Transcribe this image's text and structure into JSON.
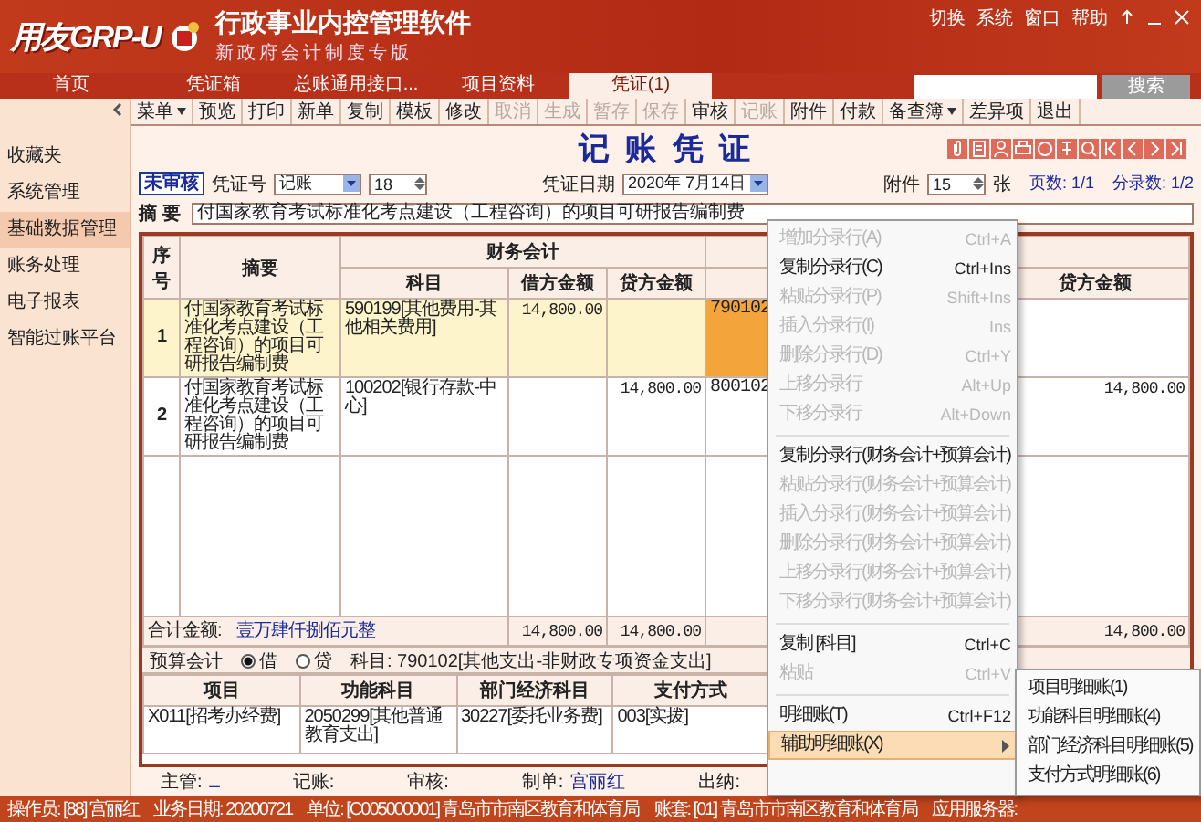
{
  "app": {
    "logo": "用友GRP-U",
    "title": "行政事业内控管理软件",
    "subtitle": "新政府会计制度专版",
    "top_menu": [
      "切换",
      "系统",
      "窗口",
      "帮助"
    ],
    "search_button": "搜索"
  },
  "tabs": [
    {
      "label": "首页",
      "selected": false
    },
    {
      "label": "凭证箱",
      "selected": false
    },
    {
      "label": "总账通用接口...",
      "selected": false
    },
    {
      "label": "项目资料",
      "selected": false
    },
    {
      "label": "凭证(1)",
      "selected": true
    }
  ],
  "sidebar": {
    "items": [
      {
        "label": "收藏夹",
        "selected": false
      },
      {
        "label": "系统管理",
        "selected": false
      },
      {
        "label": "基础数据管理",
        "selected": true
      },
      {
        "label": "账务处理",
        "selected": false
      },
      {
        "label": "电子报表",
        "selected": false
      },
      {
        "label": "智能过账平台",
        "selected": false
      }
    ]
  },
  "toolbar": [
    {
      "label": "菜单",
      "dropdown": true,
      "disabled": false
    },
    {
      "label": "预览",
      "dropdown": false,
      "disabled": false
    },
    {
      "label": "打印",
      "dropdown": false,
      "disabled": false
    },
    {
      "label": "新单",
      "dropdown": false,
      "disabled": false
    },
    {
      "label": "复制",
      "dropdown": false,
      "disabled": false
    },
    {
      "label": "模板",
      "dropdown": false,
      "disabled": false
    },
    {
      "label": "修改",
      "dropdown": false,
      "disabled": false
    },
    {
      "label": "取消",
      "dropdown": false,
      "disabled": true
    },
    {
      "label": "生成",
      "dropdown": false,
      "disabled": true
    },
    {
      "label": "暂存",
      "dropdown": false,
      "disabled": true
    },
    {
      "label": "保存",
      "dropdown": false,
      "disabled": true
    },
    {
      "label": "审核",
      "dropdown": false,
      "disabled": false
    },
    {
      "label": "记账",
      "dropdown": false,
      "disabled": true
    },
    {
      "label": "附件",
      "dropdown": false,
      "disabled": false
    },
    {
      "label": "付款",
      "dropdown": false,
      "disabled": false
    },
    {
      "label": "备查簿",
      "dropdown": true,
      "disabled": false
    },
    {
      "label": "差异项",
      "dropdown": false,
      "disabled": false
    },
    {
      "label": "退出",
      "dropdown": false,
      "disabled": false
    }
  ],
  "voucher": {
    "title": "记 账 凭 证",
    "status": "未审核",
    "number_label": "凭证号",
    "type": "记账",
    "number": "18",
    "date_label": "凭证日期",
    "date": "2020年 7月14日",
    "attach_label": "附件",
    "attachments": "15",
    "attach_unit": "张",
    "pages": "页数: 1/1",
    "entries": "分录数: 1/2",
    "summary_label": "摘 要",
    "summary": "付国家教育考试标准化考点建设（工程咨询）的项目可研报告编制费"
  },
  "table": {
    "headers": {
      "seq": "序号",
      "summary": "摘要",
      "finance": "财务会计",
      "subject": "科目",
      "debit": "借方金额",
      "credit": "贷方金额",
      "budget_credit": "贷方金额"
    },
    "rows": [
      {
        "seq": "1",
        "summary": "付国家教育考试标准化考点建设（工程咨询）的项目可研报告编制费",
        "subject": "590199[其他费用-其他相关费用]",
        "debit": "14,800.00",
        "budget_subject": "790102",
        "selected": true
      },
      {
        "seq": "2",
        "summary": "付国家教育考试标准化考点建设（工程咨询）的项目可研报告编制费",
        "subject": "100202[银行存款-中心]",
        "credit": "14,800.00",
        "budget_subject": "800102",
        "budget_credit": "14,800.00",
        "selected": false
      }
    ],
    "total": {
      "label": "合计金额:",
      "words": "壹万肆仟捌佰元整",
      "debit": "14,800.00",
      "credit": "14,800.00",
      "budget_credit": "14,800.00"
    }
  },
  "budget": {
    "label": "预算会计",
    "options": [
      {
        "label": "借",
        "selected": true
      },
      {
        "label": "贷",
        "selected": false
      }
    ],
    "subject": "科目: 790102[其他支出-非财政专项资金支出]",
    "columns": [
      "项目",
      "功能科目",
      "部门经济科目",
      "支付方式"
    ],
    "rows": [
      [
        "X011[招考办经费]",
        "2050299[其他普通教育支出]",
        "30227[委托业务费]",
        "003[实拨]"
      ]
    ]
  },
  "signatures": [
    {
      "label": "主管:",
      "value": "_"
    },
    {
      "label": "记账:"
    },
    {
      "label": "审核:"
    },
    {
      "label": "制单:",
      "value": "宫丽红"
    },
    {
      "label": "出纳:"
    }
  ],
  "context_menu": {
    "items": [
      {
        "kind": "item",
        "label": "增加分录行(A)",
        "shortcut": "Ctrl+A",
        "disabled": true
      },
      {
        "kind": "item",
        "label": "复制分录行(C)",
        "shortcut": "Ctrl+Ins",
        "disabled": false
      },
      {
        "kind": "item",
        "label": "粘贴分录行(P)",
        "shortcut": "Shift+Ins",
        "disabled": true
      },
      {
        "kind": "item",
        "label": "插入分录行(I)",
        "shortcut": "Ins",
        "disabled": true
      },
      {
        "kind": "item",
        "label": "删除分录行(D)",
        "shortcut": "Ctrl+Y",
        "disabled": true
      },
      {
        "kind": "item",
        "label": "上移分录行",
        "shortcut": "Alt+Up",
        "disabled": true
      },
      {
        "kind": "item",
        "label": "下移分录行",
        "shortcut": "Alt+Down",
        "disabled": true
      },
      {
        "kind": "separator"
      },
      {
        "kind": "item",
        "label": "复制分录行(财务会计+预算会计)",
        "disabled": false
      },
      {
        "kind": "item",
        "label": "粘贴分录行(财务会计+预算会计)",
        "disabled": true
      },
      {
        "kind": "item",
        "label": "插入分录行(财务会计+预算会计)",
        "disabled": true
      },
      {
        "kind": "item",
        "label": "删除分录行(财务会计+预算会计)",
        "disabled": true
      },
      {
        "kind": "item",
        "label": "上移分录行(财务会计+预算会计)",
        "disabled": true
      },
      {
        "kind": "item",
        "label": "下移分录行(财务会计+预算会计)",
        "disabled": true
      },
      {
        "kind": "separator"
      },
      {
        "kind": "item",
        "label": "复制 [科目]",
        "shortcut": "Ctrl+C",
        "disabled": false
      },
      {
        "kind": "item",
        "label": "粘贴",
        "shortcut": "Ctrl+V",
        "disabled": true
      },
      {
        "kind": "separator"
      },
      {
        "kind": "item",
        "label": "明细账(T)",
        "shortcut": "Ctrl+F12",
        "disabled": false
      },
      {
        "kind": "item",
        "label": "辅助明细账(X)",
        "disabled": false,
        "submenu": true,
        "selected": true
      }
    ],
    "submenu": [
      {
        "label": "项目明细账(1)"
      },
      {
        "label": "功能科目明细账(4)"
      },
      {
        "label": "部门经济科目明细账(5)"
      },
      {
        "label": "支付方式明细账(6)"
      }
    ]
  },
  "status_bar": [
    "操作员: [88] 宫丽红",
    "业务日期: 20200721",
    "单位: [C005000001] 青岛市市南区教育和体育局",
    "账套: [01] 青岛市市南区教育和体育局",
    "应用服务器:"
  ]
}
